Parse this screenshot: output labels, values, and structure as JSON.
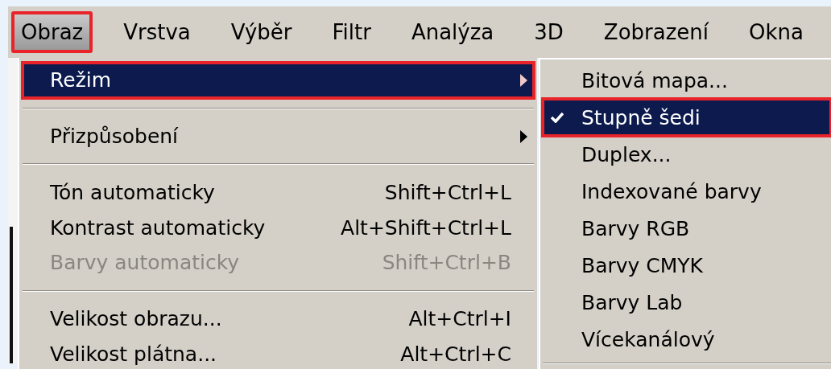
{
  "menubar": [
    {
      "label": "Obraz",
      "selected": true,
      "annotated": true
    },
    {
      "label": "Vrstva",
      "selected": false,
      "annotated": false
    },
    {
      "label": "Výběr",
      "selected": false,
      "annotated": false
    },
    {
      "label": "Filtr",
      "selected": false,
      "annotated": false
    },
    {
      "label": "Analýza",
      "selected": false,
      "annotated": false
    },
    {
      "label": "3D",
      "selected": false,
      "annotated": false
    },
    {
      "label": "Zobrazení",
      "selected": false,
      "annotated": false
    },
    {
      "label": "Okna",
      "selected": false,
      "annotated": false
    }
  ],
  "menu": [
    {
      "kind": "item",
      "label": "Režim",
      "submenu": true,
      "selected": true,
      "disabled": false,
      "annotated": true
    },
    {
      "kind": "separator"
    },
    {
      "kind": "item",
      "label": "Přizpůsobení",
      "submenu": true,
      "selected": false,
      "disabled": false,
      "annotated": false
    },
    {
      "kind": "separator"
    },
    {
      "kind": "item",
      "label": "Tón automaticky",
      "shortcut": "Shift+Ctrl+L",
      "selected": false,
      "disabled": false,
      "annotated": false
    },
    {
      "kind": "item",
      "label": "Kontrast automaticky",
      "shortcut": "Alt+Shift+Ctrl+L",
      "selected": false,
      "disabled": false,
      "annotated": false
    },
    {
      "kind": "item",
      "label": "Barvy automaticky",
      "shortcut": "Shift+Ctrl+B",
      "selected": false,
      "disabled": true,
      "annotated": false
    },
    {
      "kind": "separator"
    },
    {
      "kind": "item",
      "label": "Velikost obrazu...",
      "shortcut": "Alt+Ctrl+I",
      "selected": false,
      "disabled": false,
      "annotated": false
    },
    {
      "kind": "item",
      "label": "Velikost plátna...",
      "shortcut": "Alt+Ctrl+C",
      "selected": false,
      "disabled": false,
      "annotated": false
    }
  ],
  "submenu": [
    {
      "kind": "item",
      "label": "Bitová mapa...",
      "checked": false,
      "selected": false,
      "annotated": false
    },
    {
      "kind": "item",
      "label": "Stupně šedi",
      "checked": true,
      "selected": true,
      "annotated": true
    },
    {
      "kind": "item",
      "label": "Duplex...",
      "checked": false,
      "selected": false,
      "annotated": false
    },
    {
      "kind": "item",
      "label": "Indexované barvy",
      "checked": false,
      "selected": false,
      "annotated": false
    },
    {
      "kind": "item",
      "label": "Barvy RGB",
      "checked": false,
      "selected": false,
      "annotated": false
    },
    {
      "kind": "item",
      "label": "Barvy CMYK",
      "checked": false,
      "selected": false,
      "annotated": false
    },
    {
      "kind": "item",
      "label": "Barvy Lab",
      "checked": false,
      "selected": false,
      "annotated": false
    },
    {
      "kind": "item",
      "label": "Vícekanálový",
      "checked": false,
      "selected": false,
      "annotated": false
    },
    {
      "kind": "separator"
    }
  ]
}
